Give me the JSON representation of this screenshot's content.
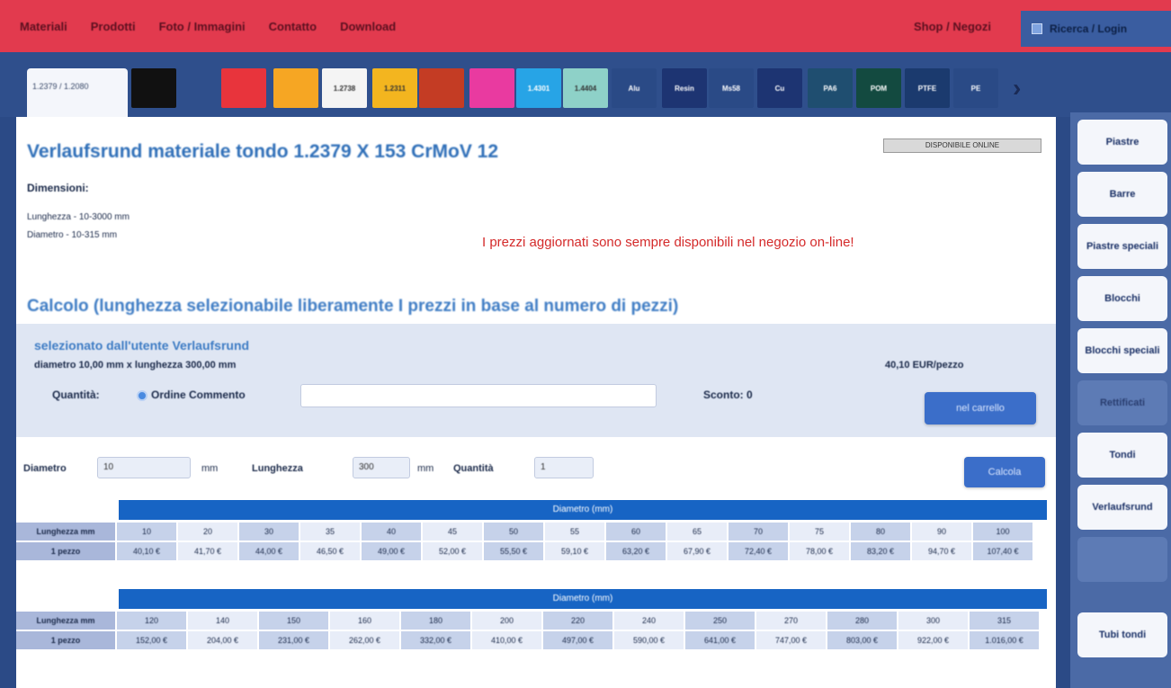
{
  "topnav": {
    "items": [
      "Materiali",
      "Prodotti",
      "Foto / Immagini",
      "Contatto",
      "Download"
    ],
    "shop": "Shop / Negozi",
    "account": "Ricerca / Login"
  },
  "material_tabs": {
    "active": "1.2379 / 1.2080",
    "swatches": [
      {
        "label": "",
        "color": "#111111"
      },
      {
        "label": "",
        "color": "#e8343c"
      },
      {
        "label": "",
        "color": "#f6a623"
      },
      {
        "label": "1.2738",
        "color": "#f4f4f4"
      },
      {
        "label": "1.2311",
        "color": "#f3b51f"
      },
      {
        "label": "",
        "color": "#c43c24"
      },
      {
        "label": "",
        "color": "#e93aa0"
      },
      {
        "label": "1.4301",
        "color": "#27a4e6"
      },
      {
        "label": "1.4404",
        "color": "#8ed1c8"
      },
      {
        "label": "Alu",
        "color": "#2a4a86"
      },
      {
        "label": "Resin",
        "color": "#1d3472"
      },
      {
        "label": "Ms58",
        "color": "#2a4a86"
      },
      {
        "label": "Cu",
        "color": "#1d3472"
      },
      {
        "label": "PA6",
        "color": "#1f4e70"
      },
      {
        "label": "POM",
        "color": "#134a40"
      },
      {
        "label": "PTFE",
        "color": "#1b3a6e"
      },
      {
        "label": "PE",
        "color": "#2a4a86"
      }
    ]
  },
  "product": {
    "title": "Verlaufsrund materiale tondo 1.2379 X 153 CrMoV 12",
    "stamp": "DISPONIBILE ONLINE",
    "dims_label": "Dimensioni:",
    "length": "Lunghezza - 10-3000 mm",
    "diameter": "Diametro - 10-315 mm",
    "promo": "I prezzi aggiornati sono sempre disponibili nel negozio on-line!"
  },
  "calc": {
    "heading": "Calcolo (lunghezza selezionabile liberamente I prezzi in base al numero di pezzi)",
    "selection_title": "selezionato dall'utente Verlaufsrund",
    "selection_info": "diametro 10,00 mm x lunghezza 300,00 mm",
    "price": "40,10 EUR/pezzo",
    "qty_label": "Quantità:",
    "order_label": "Ordine Commento",
    "comment_placeholder": "",
    "sconto_label": "Sconto: 0",
    "add_button": "nel carrello"
  },
  "filter": {
    "diameter_label": "Diametro",
    "diameter_value": "10",
    "diameter_unit": "mm",
    "length_label": "Lunghezza",
    "length_value": "300",
    "length_unit": "mm",
    "pieces_label": "Quantità",
    "pieces_value": "1",
    "calc_button": "Calcola"
  },
  "tables": [
    {
      "header": "Diametro (mm)",
      "row1_label": "Lunghezza mm",
      "row2_label": "1 pezzo",
      "diameters": [
        "10",
        "20",
        "30",
        "35",
        "40",
        "45",
        "50",
        "55",
        "60",
        "65",
        "70",
        "75",
        "80",
        "90",
        "100"
      ],
      "prices": [
        "40,10 €",
        "41,70 €",
        "44,00 €",
        "46,50 €",
        "49,00 €",
        "52,00 €",
        "55,50 €",
        "59,10 €",
        "63,20 €",
        "67,90 €",
        "72,40 €",
        "78,00 €",
        "83,20 €",
        "94,70 €",
        "107,40 €"
      ]
    },
    {
      "header": "Diametro (mm)",
      "row1_label": "Lunghezza mm",
      "row2_label": "1 pezzo",
      "diameters": [
        "120",
        "140",
        "150",
        "160",
        "180",
        "200",
        "220",
        "240",
        "250",
        "270",
        "280",
        "300",
        "315"
      ],
      "prices": [
        "152,00 €",
        "204,00 €",
        "231,00 €",
        "262,00 €",
        "332,00 €",
        "410,00 €",
        "497,00 €",
        "590,00 €",
        "641,00 €",
        "747,00 €",
        "803,00 €",
        "922,00 €",
        "1.016,00 €"
      ]
    }
  ],
  "sidebar": {
    "items": [
      {
        "label": "Piastre",
        "dim": false
      },
      {
        "label": "Barre",
        "dim": false
      },
      {
        "label": "Piastre speciali",
        "dim": false
      },
      {
        "label": "Blocchi",
        "dim": false
      },
      {
        "label": "Blocchi speciali",
        "dim": false
      },
      {
        "label": "Rettificati",
        "dim": true
      },
      {
        "label": "Tondi",
        "dim": false
      },
      {
        "label": "Verlaufsrund",
        "dim": false
      },
      {
        "label": "",
        "dim": true
      },
      {
        "label": "Tubi tondi",
        "dim": false
      }
    ]
  }
}
